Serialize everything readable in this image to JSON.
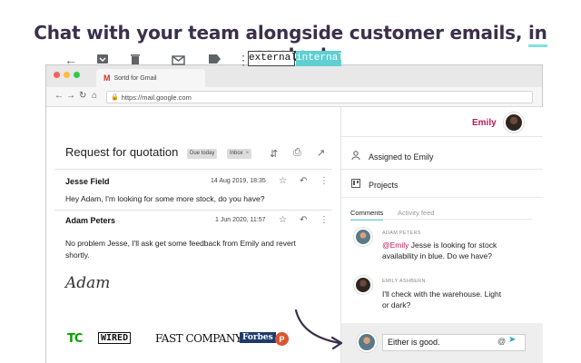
{
  "headline": {
    "main": "Chat with your team alongside customer emails, ",
    "highlight": "in context"
  },
  "browser": {
    "tab_title": "Sortd for Gmail",
    "tab_logo": "M",
    "url": "https://mail.google.com",
    "nav_icons": [
      "back-icon",
      "forward-icon",
      "reload-icon",
      "home-icon"
    ]
  },
  "gmail": {
    "toolbar_icons": [
      "back-arrow-icon",
      "archive-icon",
      "trash-icon",
      "mark-unread-icon",
      "label-icon",
      "more-icon"
    ],
    "subject": "Request for quotation",
    "labels": [
      "Due today",
      "Inbox"
    ],
    "messages": [
      {
        "sender": "Jesse Field",
        "date": "14 Aug 2019, 18:35",
        "text_lines": [
          "Hey Adam, I'm looking for some more stock, do you have?"
        ]
      },
      {
        "sender": "Adam Peters",
        "date": "1 Jun 2020, 11:57",
        "text_lines": [
          "No problem Jesse, I'll ask get some feedback from Emily and revert",
          "shortly."
        ],
        "signature": "Adam"
      }
    ]
  },
  "sortd_panel": {
    "tab_external": "external",
    "tab_internal": "internal",
    "user_name": "Emily",
    "assigned_text": "Assigned to Emily",
    "projects_label": "Projects",
    "comment_tabs": [
      "Comments",
      "Activity feed"
    ],
    "comments": [
      {
        "author": "ADAM PETERS",
        "mention": "@Emily",
        "text_line1": " Jesse is looking for stock",
        "text_line2": "availability in blue. Do we have?"
      },
      {
        "author": "EMILY ASHBERN",
        "text_line1": "I'll check with the warehouse. Light",
        "text_line2": "or dark?"
      }
    ],
    "compose_value": "Either is good.",
    "accent_color": "#5fcfd2",
    "user_color": "#c2185b"
  },
  "press_logos": [
    "TC",
    "WIRED",
    "FAST COMPANY",
    "Forbes",
    "P"
  ]
}
